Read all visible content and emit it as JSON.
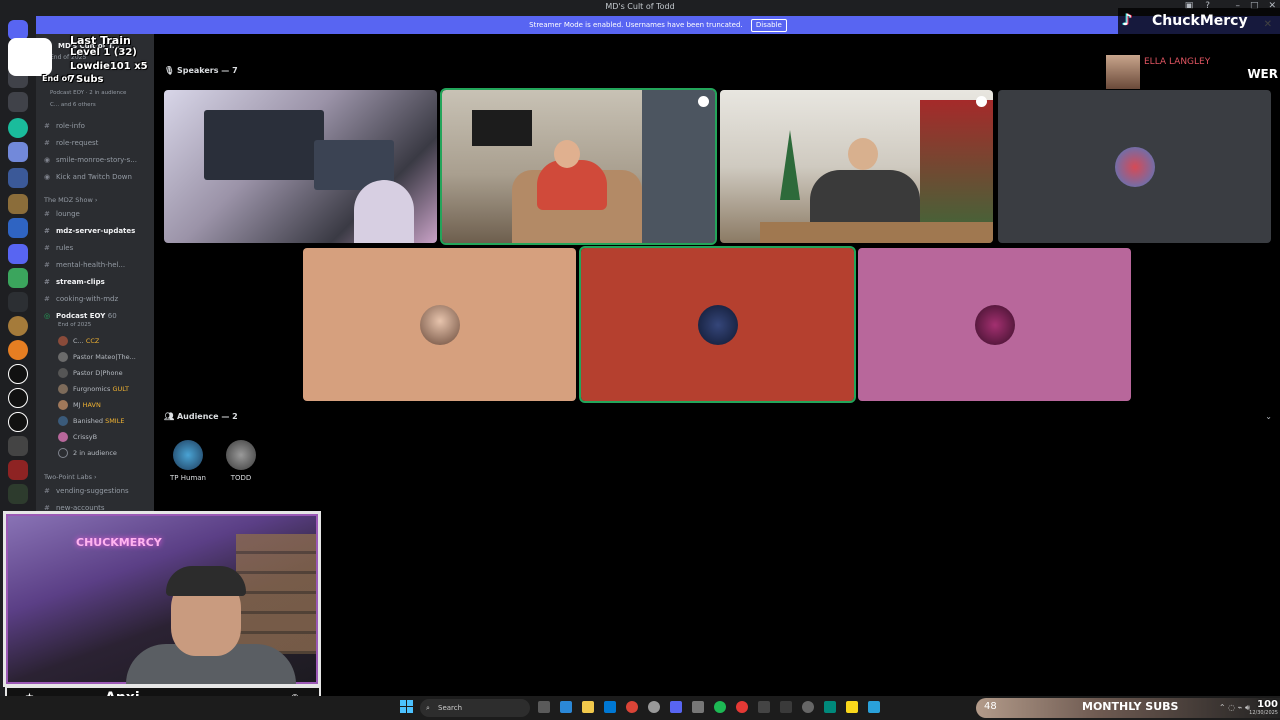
{
  "window": {
    "title": "MD's Cult of Todd",
    "minimize": "–",
    "maximize": "□",
    "close": "✕"
  },
  "banner": {
    "message": "Streamer Mode is enabled. Usernames have been truncated.",
    "disable_label": "Disable",
    "close": "✕"
  },
  "overlay": {
    "last_train": "Last Train",
    "level": "Level 1 (32)",
    "lowdie": "Lowdie101 x5",
    "subs": "Subs",
    "end_of": "End of",
    "seven": "7"
  },
  "sidebar": {
    "server_name": "MD's Cult of T...",
    "event_title": "End of 2025",
    "event_sub": "Podcast EOY",
    "event_audience": "2 in audience",
    "event_others": "C... and 6 others",
    "channels_top": [
      {
        "name": "role-info"
      },
      {
        "name": "role-request"
      },
      {
        "name": "smile-monroe-story-s..."
      },
      {
        "name": "Kick and Twitch Down"
      }
    ],
    "category_mdz": "The MDZ Show",
    "channels_mdz": [
      {
        "name": "lounge",
        "bold": false
      },
      {
        "name": "mdz-server-updates",
        "bold": true
      },
      {
        "name": "rules",
        "bold": false
      },
      {
        "name": "mental-health-hel...",
        "bold": false
      },
      {
        "name": "stream-clips",
        "bold": true
      },
      {
        "name": "cooking-with-mdz",
        "bold": false
      }
    ],
    "stage": {
      "name": "Podcast EOY",
      "sub": "End of 2025",
      "count": "60"
    },
    "stage_users": [
      {
        "name": "C...",
        "tag": "CCZ"
      },
      {
        "name": "Pastor Mateo|The...",
        "tag": ""
      },
      {
        "name": "Pastor D|Phone",
        "tag": ""
      },
      {
        "name": "Furgnomics",
        "tag": "GULT"
      },
      {
        "name": "MJ",
        "tag": "HAVN"
      },
      {
        "name": "Banished",
        "tag": "SMILE"
      },
      {
        "name": "CrissyB",
        "tag": ""
      },
      {
        "name": "2 in audience",
        "tag": ""
      }
    ],
    "category_two_point": "Two-Point Labs",
    "channels_bottom": [
      {
        "name": "vending-suggestions"
      },
      {
        "name": "new-accounts"
      }
    ]
  },
  "stage": {
    "speakers_heading": "Speakers — 7",
    "audience_heading": "Audience — 2",
    "audience": [
      {
        "name": "TP Human"
      },
      {
        "name": "TODD"
      }
    ],
    "tile_colors": {
      "tan": "#d6a07e",
      "red": "#b5402f",
      "pink": "#b8679b",
      "gray": "#3a3d42",
      "speaking": "#23a55a"
    }
  },
  "tiktok": {
    "name": "ChuckMercy"
  },
  "alert": {
    "name": "ELLA LANGLEY",
    "trailing": "WER"
  },
  "webcam": {
    "sign_text": "CHUCKMERCY",
    "caption": "Anxi"
  },
  "taskbar": {
    "search_label": "Search"
  },
  "subs_bar": {
    "count": "48",
    "label": "MONTHLY SUBS",
    "percent": "100",
    "clock": "12/30/2025"
  }
}
